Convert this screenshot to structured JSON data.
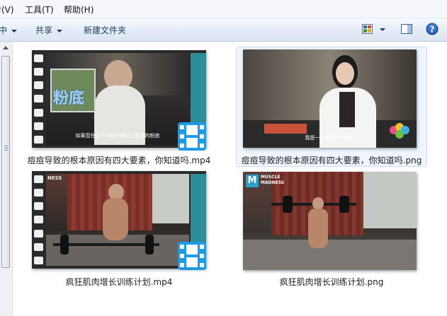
{
  "menu": {
    "view": "看(V)",
    "tools": "工具(T)",
    "help": "帮助(H)"
  },
  "toolbar": {
    "library_partial": "中",
    "share": "共享",
    "new_folder": "新建文件夹"
  },
  "files": [
    {
      "name": "痘痘导致的根本原因有四大要素，你知道吗.mp4",
      "type": "video",
      "overlay_text": "粉底",
      "subtitle": "如果您在这个过程中再涂上厚厚的粉底"
    },
    {
      "name": "痘痘导致的根本原因有四大要素，你知道吗.png",
      "type": "image",
      "subtitle": "我是一名皮肤科的医生",
      "selected": true
    },
    {
      "name": "疯狂肌肉增长训练计划.mp4",
      "type": "video",
      "logo_text": "NESS"
    },
    {
      "name": "疯狂肌肉增长训练计划.png",
      "type": "image",
      "logo_text": "MUSCLE MADNESS",
      "logo_letter": "M"
    }
  ],
  "colors": {
    "toolbar_text": "#1e395b",
    "selection_border": "#c9dcf3",
    "video_badge": "#1e9be6"
  }
}
